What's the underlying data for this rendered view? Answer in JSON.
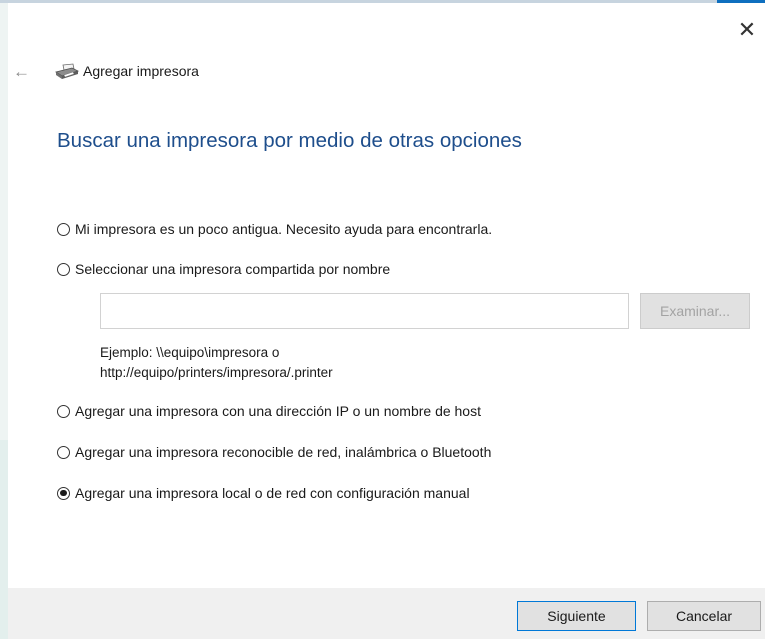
{
  "window": {
    "close_symbol": "✕",
    "back_symbol": "←",
    "title": "Agregar impresora",
    "icon": "printer-icon"
  },
  "heading": "Buscar una impresora por medio de otras opciones",
  "options": [
    {
      "label": "Mi impresora es un poco antigua. Necesito ayuda para encontrarla.",
      "checked": false
    },
    {
      "label": "Seleccionar una impresora compartida por nombre",
      "checked": false
    },
    {
      "label": "Agregar una impresora con una dirección IP o un nombre de host",
      "checked": false
    },
    {
      "label": "Agregar una impresora reconocible de red, inalámbrica o Bluetooth",
      "checked": false
    },
    {
      "label": "Agregar una impresora local o de red con configuración manual",
      "checked": true
    }
  ],
  "shared_printer": {
    "input_value": "",
    "browse_label": "Examinar...",
    "example_line1": "Ejemplo: \\\\equipo\\impresora o",
    "example_line2": "http://equipo/printers/impresora/.printer"
  },
  "buttons": {
    "next": "Siguiente",
    "cancel": "Cancelar"
  },
  "colors": {
    "heading": "#1e4e8c",
    "accent": "#0078d7",
    "footer": "#f0f0f0"
  }
}
